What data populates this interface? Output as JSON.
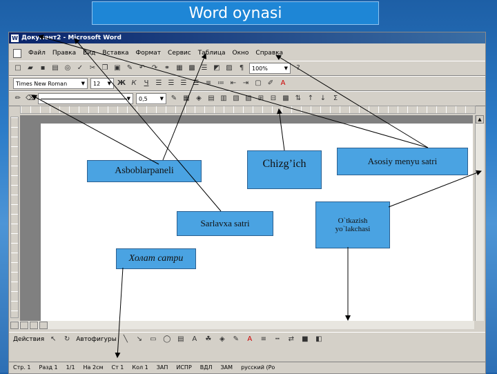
{
  "slide": {
    "title": "Word oynasi"
  },
  "window": {
    "title": "Документ2 - Microsoft Word",
    "menu": [
      "Файл",
      "Правка",
      "Вид",
      "Вставка",
      "Формат",
      "Сервис",
      "Таблица",
      "Окно",
      "Справка"
    ],
    "font_name": "Times New Roman",
    "font_size": "12",
    "zoom": "100%",
    "line_width": "0,5",
    "draw_menu": "Действия",
    "autoshapes": "Автофигуры",
    "status": [
      "Стр. 1",
      "Разд 1",
      "1/1",
      "На 2см",
      "Ст 1",
      "Кол 1",
      "ЗАП",
      "ИСПР",
      "ВДЛ",
      "ЗАМ",
      "русский (Ро"
    ]
  },
  "callouts": {
    "asboblar": "Asboblarpaneli",
    "chizgich": "Chizg’ich",
    "asosiy": "Asosiy menyu satri",
    "sarlavxa": "Sarlavxa  satri",
    "otkazish_1": "O`tkazish",
    "otkazish_2": "yo`lakchasi",
    "holat": "Холат сатри"
  },
  "colors": {
    "callout": "#4aa3e2",
    "titlebar": "#0a246a",
    "arrow": "#000000"
  }
}
